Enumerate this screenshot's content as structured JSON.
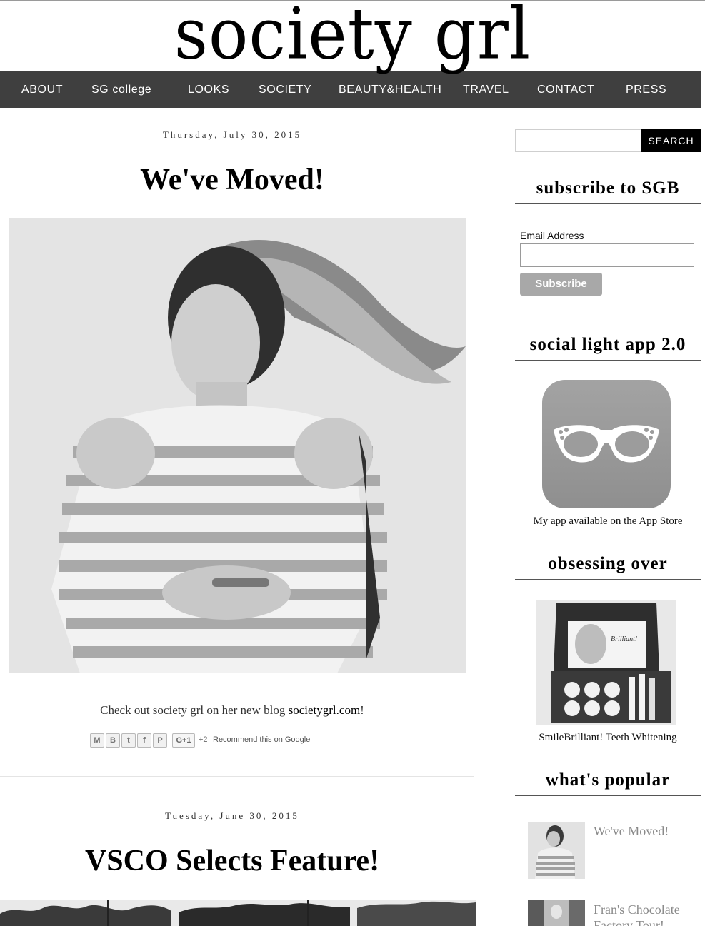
{
  "site": {
    "logo": "society grl"
  },
  "nav": {
    "items": [
      {
        "label": "ABOUT"
      },
      {
        "label": "SG college"
      },
      {
        "label": "LOOKS"
      },
      {
        "label": "SOCIETY"
      },
      {
        "label": "BEAUTY&HEALTH"
      },
      {
        "label": "TRAVEL"
      },
      {
        "label": "CONTACT"
      },
      {
        "label": "PRESS"
      }
    ]
  },
  "posts": [
    {
      "date": "Thursday, July 30, 2015",
      "title": "We've Moved!",
      "body_prefix": "Check out society grl on her new blog ",
      "body_link": "societygrl.com",
      "body_suffix": "!",
      "share": {
        "buttons": [
          "M",
          "B",
          "t",
          "f",
          "P"
        ],
        "gplus_label": "G+1",
        "gplus_count": "+2",
        "gplus_text": "Recommend this on Google"
      }
    },
    {
      "date": "Tuesday, June 30, 2015",
      "title": "VSCO Selects Feature!"
    }
  ],
  "sidebar": {
    "search": {
      "button_label": "SEARCH",
      "placeholder": ""
    },
    "subscribe": {
      "title": "subscribe to SGB",
      "email_label": "Email Address",
      "button_label": "Subscribe"
    },
    "app": {
      "title": "social light app 2.0",
      "caption": "My app available on the App Store",
      "icon": "sunglasses-icon"
    },
    "obsessing": {
      "title": "obsessing over",
      "caption": "SmileBrilliant! Teeth Whitening",
      "box_text": "Brilliant!"
    },
    "popular": {
      "title": "what's popular",
      "items": [
        {
          "title": "We've Moved!"
        },
        {
          "title": "Fran's Chocolate Factory Tour!"
        }
      ]
    }
  },
  "colors": {
    "nav_bg": "#3f3f3f",
    "nav_text": "#ffffff",
    "search_button_bg": "#000000",
    "subscribe_button_bg": "#a8a8a8",
    "popular_link": "#8a8a8a"
  }
}
